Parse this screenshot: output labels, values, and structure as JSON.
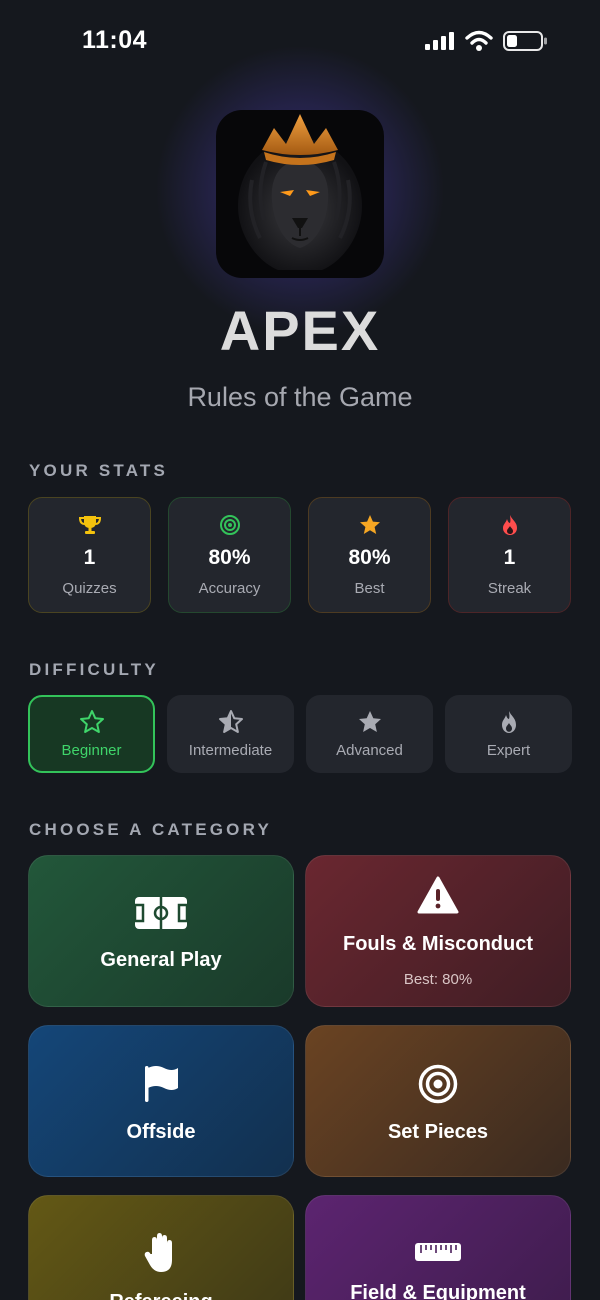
{
  "status_bar": {
    "time": "11:04"
  },
  "app": {
    "name": "APEX",
    "subtitle": "Rules of the Game"
  },
  "stats": {
    "label": "YOUR STATS",
    "items": [
      {
        "value": "1",
        "label": "Quizzes",
        "icon": "trophy-icon",
        "color": "#f4c20d"
      },
      {
        "value": "80%",
        "label": "Accuracy",
        "icon": "target-icon",
        "color": "#33c35a"
      },
      {
        "value": "80%",
        "label": "Best",
        "icon": "star-icon",
        "color": "#f5a623"
      },
      {
        "value": "1",
        "label": "Streak",
        "icon": "flame-icon",
        "color": "#ff4d4d"
      }
    ]
  },
  "difficulty": {
    "label": "DIFFICULTY",
    "selected": "Beginner",
    "options": [
      {
        "label": "Beginner",
        "icon": "star-outline-icon"
      },
      {
        "label": "Intermediate",
        "icon": "half-star-icon"
      },
      {
        "label": "Advanced",
        "icon": "star-filled-icon"
      },
      {
        "label": "Expert",
        "icon": "flame-icon"
      }
    ]
  },
  "categories": {
    "label": "CHOOSE A CATEGORY",
    "items": [
      {
        "title": "General Play",
        "best": "",
        "icon": "pitch-icon",
        "color": "#1e4a30"
      },
      {
        "title": "Fouls & Misconduct",
        "best": "Best: 80%",
        "icon": "warning-icon",
        "color": "#5a2228"
      },
      {
        "title": "Offside",
        "best": "",
        "icon": "flag-icon",
        "color": "#12385e"
      },
      {
        "title": "Set Pieces",
        "best": "",
        "icon": "target-icon",
        "color": "#533620"
      },
      {
        "title": "Refereeing",
        "best": "",
        "icon": "hand-icon",
        "color": "#4f4610"
      },
      {
        "title": "Field & Equipment",
        "best": "",
        "icon": "ruler-icon",
        "color": "#4a1d5c"
      }
    ]
  },
  "colors": {
    "accent": "#33c35a",
    "background": "#15181e",
    "card": "#23262d"
  }
}
